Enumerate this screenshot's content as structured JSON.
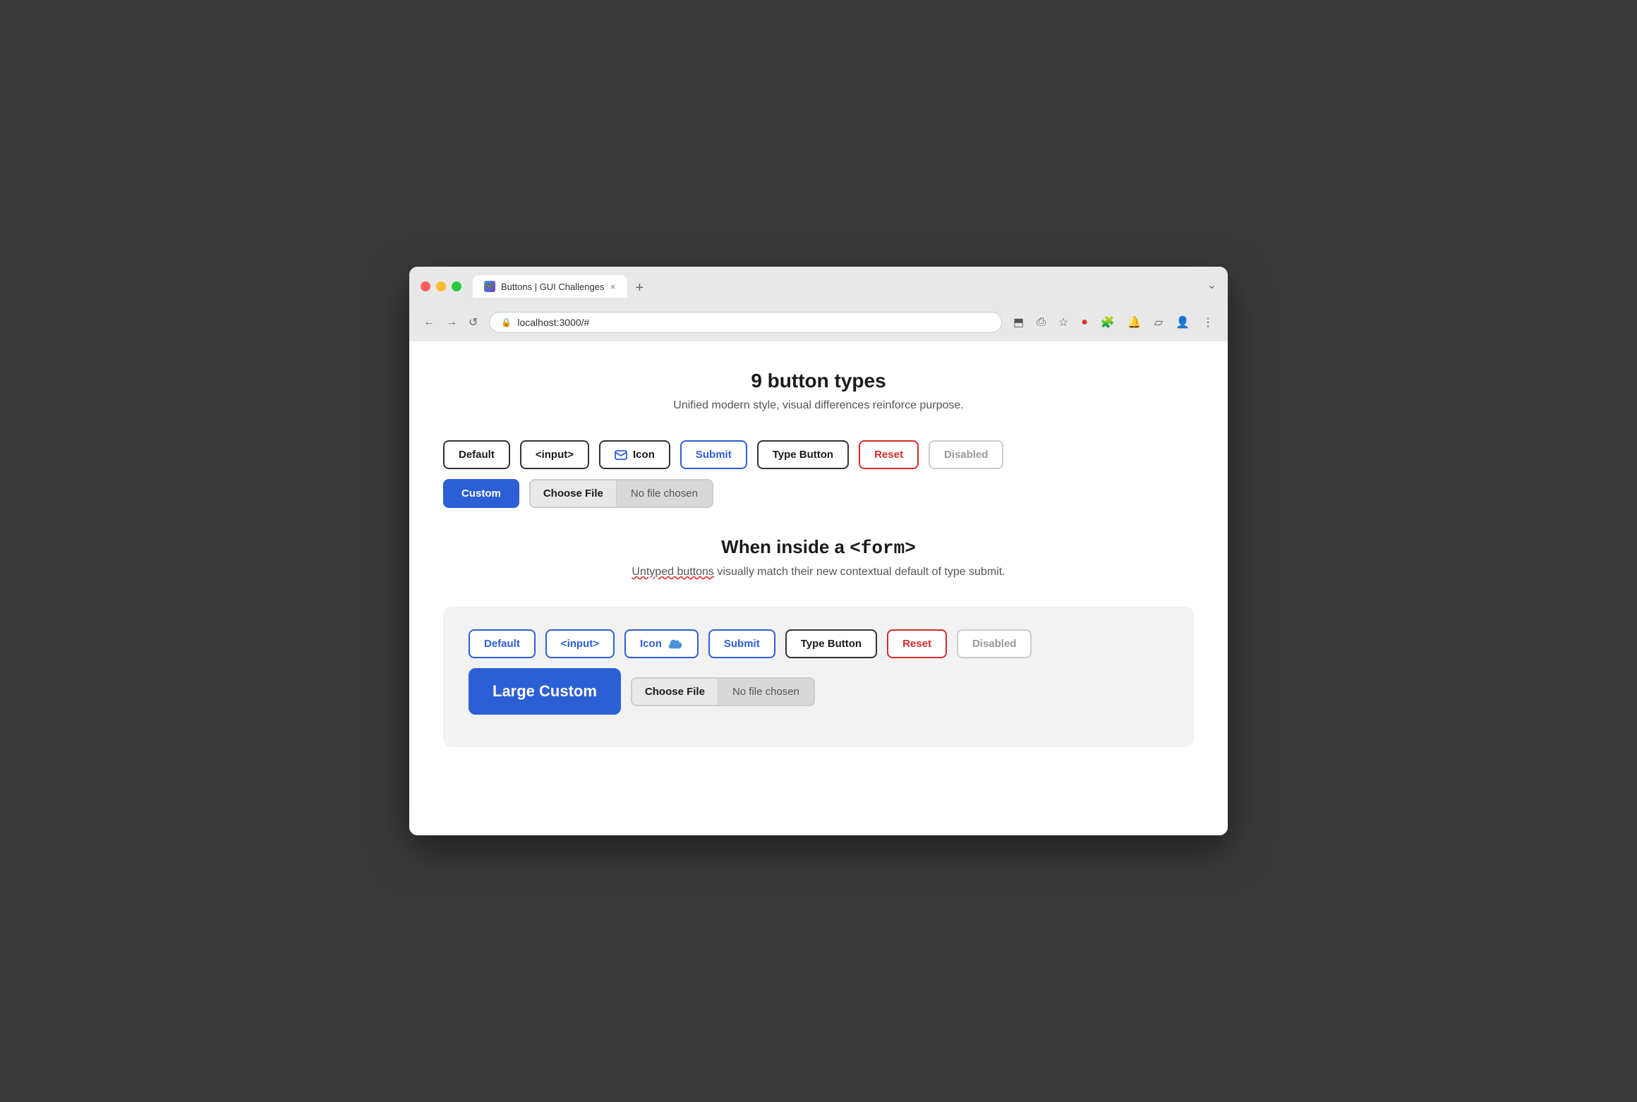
{
  "browser": {
    "tab_label": "Buttons | GUI Challenges",
    "tab_close": "×",
    "tab_new": "+",
    "tab_end": "⌄",
    "nav_back": "←",
    "nav_forward": "→",
    "nav_reload": "↺",
    "address": "localhost:3000/#",
    "toolbar_icons": [
      "⬒",
      "⎙",
      "★",
      "🔴",
      "🧩",
      "🔔",
      "▱",
      "👤",
      "⋮"
    ]
  },
  "page": {
    "title": "9 button types",
    "subtitle": "Unified modern style, visual differences reinforce purpose."
  },
  "buttons_row1": {
    "default_label": "Default",
    "input_label": "<input>",
    "icon_label": "Icon",
    "submit_label": "Submit",
    "type_button_label": "Type Button",
    "reset_label": "Reset",
    "disabled_label": "Disabled"
  },
  "buttons_row2": {
    "custom_label": "Custom",
    "choose_file_label": "Choose File",
    "no_file_label": "No file chosen"
  },
  "form_section": {
    "title_prefix": "When inside a ",
    "title_code": "<form>",
    "subtitle_part1": "Untyped buttons",
    "subtitle_part2": " visually match their new contextual default of type submit."
  },
  "form_buttons_row1": {
    "default_label": "Default",
    "input_label": "<input>",
    "icon_label": "Icon",
    "submit_label": "Submit",
    "type_button_label": "Type Button",
    "reset_label": "Reset",
    "disabled_label": "Disabled"
  },
  "form_buttons_row2": {
    "large_custom_label": "Large Custom",
    "choose_file_label": "Choose File",
    "no_file_label": "No file chosen"
  }
}
